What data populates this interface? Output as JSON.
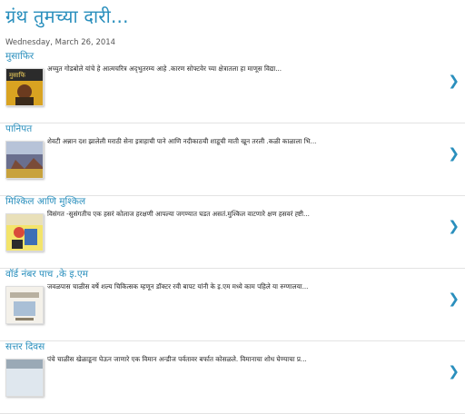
{
  "blog": {
    "title": "ग्रंथ तुमच्या दारी..."
  },
  "date_header": "Wednesday, March 26, 2014",
  "posts": [
    {
      "title": "मुसाफिर",
      "snippet": "अच्युत गोडबोले यांचे हे आत्मचरित्र अद्‌भुतरम्य आहे .कारण सोफ्टवेर च्या क्षेत्रातला हा माणूस विद्या...",
      "thumbnail": "book-cover-musafir",
      "more_icon": "chevron-right-icon"
    },
    {
      "title": "पानिपत",
      "snippet": "शेवटी अन्नान दश झालेली मराठी सेना इत्राहाची पाने आणि नदीकाठची शाडूची माती खून तरली .कळी काळाला भि...",
      "thumbnail": "book-cover-panipat",
      "more_icon": "chevron-right-icon"
    },
    {
      "title": "मिश्किल आणि मुश्किल",
      "snippet": "विसंगत -सुसंगतीच एक हसरं कोलाज हरक्षणी आपल्या जगण्यात घडत असतं.मुश्किल वाटणारे क्षण हसवरं ह्ष्टी...",
      "thumbnail": "book-cover-mishkil",
      "more_icon": "chevron-right-icon"
    },
    {
      "title": "वॉर्ड नंबर पाच ,के इ.एम",
      "snippet": "जवळपास चाळीस वर्षे शल्य चिकित्सक म्हणून डॉक्टर रवी बापट यांनी के इ.एम मध्ये काम पहिले या रुग्णालया...",
      "thumbnail": "book-cover-ward-5",
      "more_icon": "chevron-right-icon"
    },
    {
      "title": "सत्तर दिवस",
      "snippet": "पंचे चाळीस खेळाडूना घेऊन जाणारे एक विमान अन्डीज पर्वतावर बर्फात कोसळले. विमानाचा शोध घेण्याचा प्र...",
      "thumbnail": "book-cover-sattar-divas",
      "more_icon": "chevron-right-icon"
    }
  ]
}
